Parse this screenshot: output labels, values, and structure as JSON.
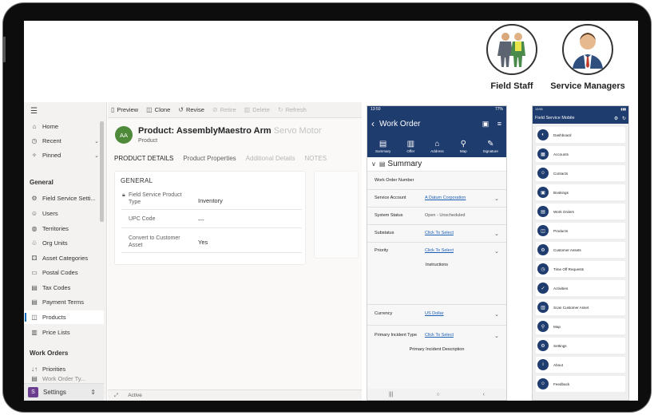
{
  "personas": [
    {
      "label": "Field Staff"
    },
    {
      "label": "Service Managers"
    }
  ],
  "nav": {
    "top_items": [
      {
        "label": "Home",
        "icon": "home-icon",
        "glyph": "⌂"
      },
      {
        "label": "Recent",
        "icon": "clock-icon",
        "glyph": "◷"
      },
      {
        "label": "Pinned",
        "icon": "pin-icon",
        "glyph": "✧"
      }
    ],
    "group_general": "General",
    "general_items": [
      {
        "label": "Field Service Setti...",
        "icon": "gear-icon",
        "glyph": "⚙"
      },
      {
        "label": "Users",
        "icon": "user-icon",
        "glyph": "☺"
      },
      {
        "label": "Territories",
        "icon": "globe-icon",
        "glyph": "◍"
      },
      {
        "label": "Org Units",
        "icon": "org-icon",
        "glyph": "♧"
      },
      {
        "label": "Asset Categories",
        "icon": "asset-icon",
        "glyph": "⚃"
      },
      {
        "label": "Postal Codes",
        "icon": "mailbox-icon",
        "glyph": "▭"
      },
      {
        "label": "Tax Codes",
        "icon": "tax-icon",
        "glyph": "▤"
      },
      {
        "label": "Payment Terms",
        "icon": "payment-icon",
        "glyph": "▤"
      },
      {
        "label": "Products",
        "icon": "box-icon",
        "glyph": "◫"
      },
      {
        "label": "Price Lists",
        "icon": "list-icon",
        "glyph": "▥"
      }
    ],
    "group_work_orders": "Work Orders",
    "wo_items": [
      {
        "label": "Priorities",
        "icon": "priority-icon",
        "glyph": "↓↑"
      },
      {
        "label": "Work Order Ty...",
        "icon": "type-icon",
        "glyph": "▤"
      }
    ],
    "area": {
      "badge": "S",
      "label": "Settings"
    }
  },
  "toolbar": {
    "preview": "Preview",
    "clone": "Clone",
    "revise": "Revise",
    "retire": "Retire",
    "delete": "Delete",
    "refresh": "Refresh"
  },
  "product": {
    "initials": "AA",
    "title": "Product: AssemblyMaestro Arm",
    "title_fade": "Servo Motor",
    "entity": "Product",
    "tabs": [
      "PRODUCT DETAILS",
      "Product Properties",
      "Additional Details",
      "NOTES"
    ],
    "section": "GENERAL",
    "fields": [
      {
        "label_1": "Field Service Product",
        "label_2": "Type",
        "value": "Inventory"
      },
      {
        "label_1": "UPC Code",
        "label_2": "",
        "value": "---"
      },
      {
        "label_1": "Convert to Customer",
        "label_2": "Asset",
        "value": "Yes"
      }
    ],
    "status": "Active"
  },
  "work_order": {
    "time": "13:50",
    "battery": "77%",
    "title": "Work Order",
    "tabs": [
      "Summary",
      "Offer",
      "Address",
      "Map",
      "Signature"
    ],
    "section": "Summary",
    "rows": [
      {
        "label": "Work Order Number",
        "value": ""
      },
      {
        "label": "Service Account",
        "value": "A Datum Corporation"
      },
      {
        "label": "System Status",
        "value": "Open - Unscheduled"
      },
      {
        "label": "Substatus",
        "value": "Click To Select"
      },
      {
        "label": "Priority",
        "value": "Click To Select"
      },
      {
        "label": "Currency",
        "value": "US Dollar"
      },
      {
        "label": "Primary Incident Type",
        "value": "Click To Select"
      }
    ],
    "instructions": "Instructions",
    "primary_incident_description": "Primary Incident Description"
  },
  "fs_mobile": {
    "time": "13:51",
    "title": "Field Service Mobile",
    "items": [
      "Dashboard",
      "Accounts",
      "Contacts",
      "Bookings",
      "Work Orders",
      "Products",
      "Customer Assets",
      "Time Off Requests",
      "Activities",
      "Scan Customer Asset",
      "Map",
      "Settings",
      "About",
      "Feedback"
    ]
  }
}
